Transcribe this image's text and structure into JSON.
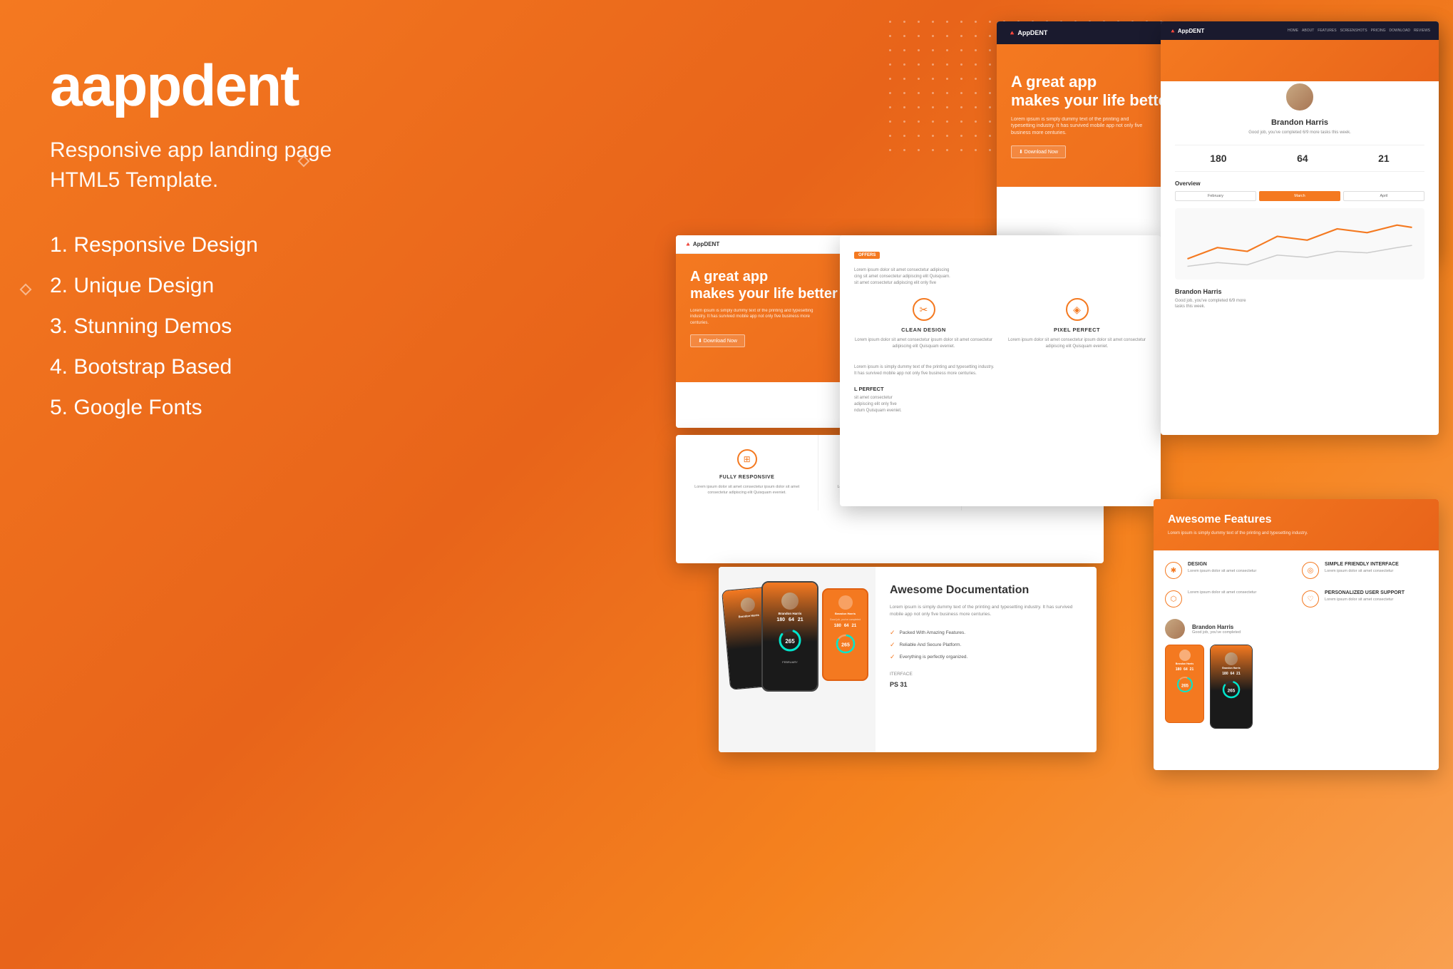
{
  "brand": {
    "name": "appdent",
    "tagline": "Responsive app landing page\nHTML5 Template.",
    "features": [
      "1. Responsive Design",
      "2. Unique Design",
      "3. Stunning Demos",
      "4. Bootstrap Based",
      "5. Google Fonts"
    ]
  },
  "preview_hero": {
    "title": "A great app\nmakes your life better",
    "body": "Lorem ipsum is simply dummy text of the printing and typesetting industry. It has survived mobile app not only five business more centuries.",
    "cta": "⬇ Download Now",
    "nav_logo": "AppDENT",
    "nav_links": [
      "HOME",
      "ABOUT",
      "FEATURES",
      "SCREENSHOTS",
      "PRICING",
      "DOWNLOAD",
      "REVIEWS"
    ]
  },
  "preview_hero2": {
    "title": "A great app\nmakes your life better",
    "body": "Lorem ipsum is simply dummy text of the printing and typesetting industry. It has survived mobile app not only five business more centuries.",
    "cta": "⬇ Download Now"
  },
  "profile": {
    "name": "Brandon Harris",
    "sub": "Good job, you've completed 6/9 more\ntasks this week.",
    "stats": [
      {
        "num": "180",
        "label": ""
      },
      {
        "num": "64",
        "label": ""
      },
      {
        "num": "21",
        "label": ""
      }
    ],
    "gauge_value": "265",
    "months": [
      "February",
      "March",
      "April"
    ]
  },
  "features_section": {
    "items": [
      {
        "icon": "⊞",
        "title": "FULLY RESPONSIVE",
        "text": "Lorem ipsum dolor sit amet consectetur ipsum dolor sit amet consectetur adipiscing elit Quisquam eveniet."
      },
      {
        "icon": "✂",
        "title": "CLEAN DESIGN",
        "text": "Lorem ipsum dolor sit amet consectetur ipsum dolor sit amet consectetur adipiscing elit Quisquam eveniet."
      },
      {
        "icon": "◈",
        "title": "PIXEL PERFECT",
        "text": "Lorem ipsum dolor sit amet consectetur ipsum dolor sit amet consectetur adipiscing elit Quisquam eveniet."
      }
    ]
  },
  "clean_design": {
    "items": [
      {
        "icon": "✂",
        "title": "CLEAN DESIGN",
        "text": "Lorem ipsum dolor sit amet consectetur ipsum dolor sit amet consectetur adipiscing elit Quisquam eveniet."
      },
      {
        "icon": "◈",
        "title": "PIXEL PERFECT",
        "text": "Lorem ipsum dolor sit amet consectetur ipsum dolor sit amet consectetur adipiscing elit Quisquam eveniet."
      }
    ]
  },
  "documentation": {
    "title": "Awesome Documentation",
    "body": "Lorem ipsum is simply dummy text of the printing and typesetting industry. It has survived mobile app not only five business more centuries.",
    "checks": [
      "Packed With Amazing Features.",
      "Reliable And Secure Platform.",
      "Everything is perfectly organized."
    ]
  },
  "awesome_features": {
    "title": "Awesome Features",
    "subtitle": "Lorem ipsum is simply dummy text of the printing and typesetting industry.",
    "items": [
      {
        "icon": "✱",
        "title": "DESIGN",
        "text": "Lorem ipsum dolor sit amet consectetur"
      },
      {
        "icon": "◎",
        "title": "SIMPLE FRIENDLY INTERFACE",
        "text": "Lorem ipsum dolor sit amet consectetur"
      },
      {
        "icon": "⬡",
        "title": "",
        "text": "Lorem ipsum dolor sit amet consectetur"
      },
      {
        "icon": "♡",
        "title": "PERSONALIZED USER SUPPORT",
        "text": "Lorem ipsum dolor sit amet consectetur"
      }
    ]
  },
  "top_right_hero": {
    "title": "A great app\nmakes your life better",
    "body": "Lorem ipsum is simply dummy text of the printing and typesetting industry. It has survived mobile app not only five business more centuries.",
    "nav_logo": "AppDENT",
    "nav_links": [
      "HOME",
      "ABOUT",
      "FEATURES",
      "SCREENSHOTS",
      "PRICING",
      "DOWNLOAD",
      "REVIEWS"
    ]
  }
}
